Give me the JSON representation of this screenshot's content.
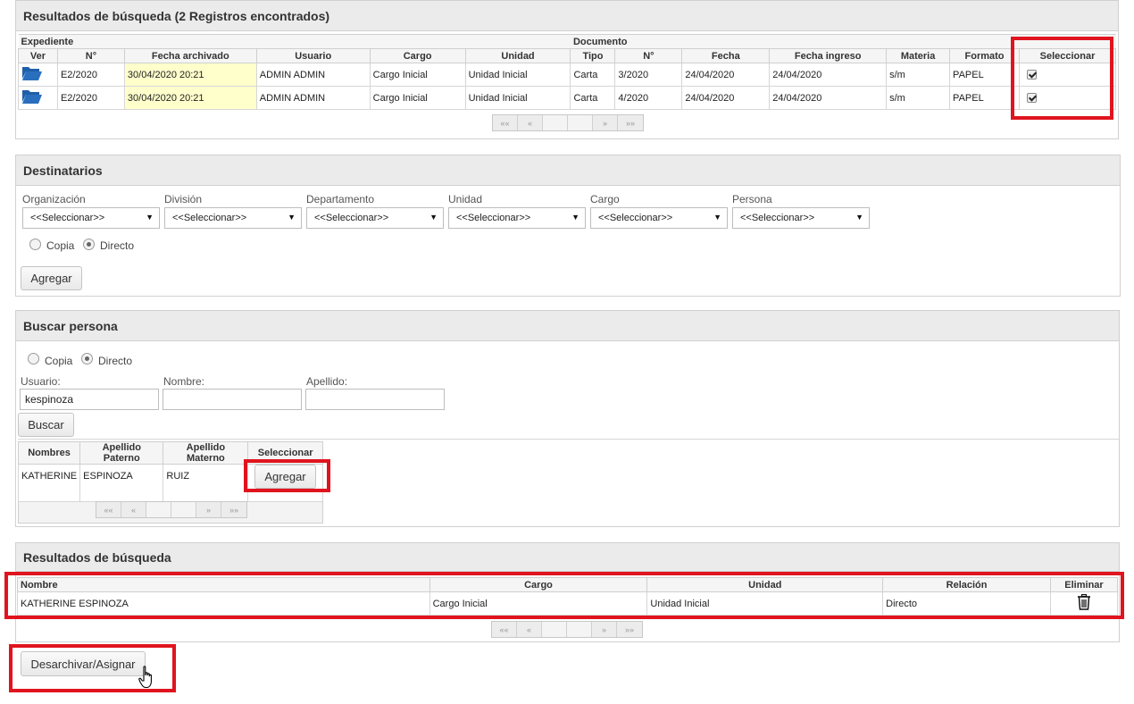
{
  "results1": {
    "title": "Resultados de búsqueda (2 Registros encontrados)",
    "group_expediente": "Expediente",
    "group_documento": "Documento",
    "columns": [
      "Ver",
      "N°",
      "Fecha archivado",
      "Usuario",
      "Cargo",
      "Unidad",
      "Tipo",
      "N°",
      "Fecha",
      "Fecha ingreso",
      "Materia",
      "Formato",
      "Seleccionar"
    ],
    "rows": [
      [
        "E2/2020",
        "30/04/2020 20:21",
        "ADMIN ADMIN",
        "Cargo Inicial",
        "Unidad Inicial",
        "Carta",
        "3/2020",
        "24/04/2020",
        "24/04/2020",
        "s/m",
        "PAPEL"
      ],
      [
        "E2/2020",
        "30/04/2020 20:21",
        "ADMIN ADMIN",
        "Cargo Inicial",
        "Unidad Inicial",
        "Carta",
        "4/2020",
        "24/04/2020",
        "24/04/2020",
        "s/m",
        "PAPEL"
      ]
    ]
  },
  "pager": {
    "first": "««",
    "prev": "«",
    "next": "»",
    "last": "»»"
  },
  "destinatarios": {
    "title": "Destinatarios",
    "labels": [
      "Organización",
      "División",
      "Departamento",
      "Unidad",
      "Cargo",
      "Persona"
    ],
    "select_value": "<<Seleccionar>>",
    "copia": "Copia",
    "directo": "Directo",
    "add_button": "Agregar"
  },
  "buscar": {
    "title": "Buscar persona",
    "copia": "Copia",
    "directo": "Directo",
    "usuario_label": "Usuario:",
    "nombre_label": "Nombre:",
    "apellido_label": "Apellido:",
    "usuario_value": "kespinoza",
    "search_button": "Buscar",
    "columns": [
      "Nombres",
      "Apellido Paterno",
      "Apellido Materno",
      "Seleccionar"
    ],
    "row": [
      "KATHERINE",
      "ESPINOZA",
      "RUIZ"
    ],
    "add_button": "Agregar"
  },
  "results2": {
    "title": "Resultados de búsqueda",
    "columns": [
      "Nombre",
      "Cargo",
      "Unidad",
      "Relación",
      "Eliminar"
    ],
    "row": [
      "KATHERINE ESPINOZA",
      "Cargo Inicial",
      "Unidad Inicial",
      "Directo"
    ]
  },
  "action_button": "Desarchivar/Asignar",
  "colors": {
    "highlight": "#e0141e",
    "folder": "#1f5fa8",
    "date_highlight": "#ffffcc"
  },
  "icons": {
    "view": "folder-open-icon",
    "delete": "trash-icon",
    "cursor": "hand-pointer-icon"
  }
}
